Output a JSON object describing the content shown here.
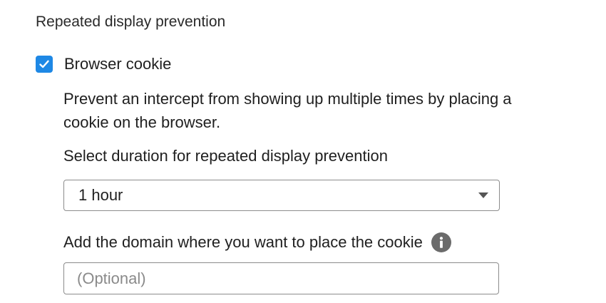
{
  "section": {
    "title": "Repeated display prevention"
  },
  "browser_cookie": {
    "label": "Browser cookie",
    "checked": true,
    "description": "Prevent an intercept from showing up multiple times by placing a cookie on the browser."
  },
  "duration": {
    "label": "Select duration for repeated display prevention",
    "selected": "1 hour"
  },
  "domain": {
    "label": "Add the domain where you want to place the cookie",
    "value": "",
    "placeholder": "(Optional)"
  },
  "icons": {
    "checkbox": "check-icon",
    "dropdown": "chevron-down-icon",
    "info": "info-icon"
  },
  "colors": {
    "checkbox_fill": "#1e88e5",
    "info_icon": "#6b6b6b",
    "border": "#8c8c8c"
  }
}
